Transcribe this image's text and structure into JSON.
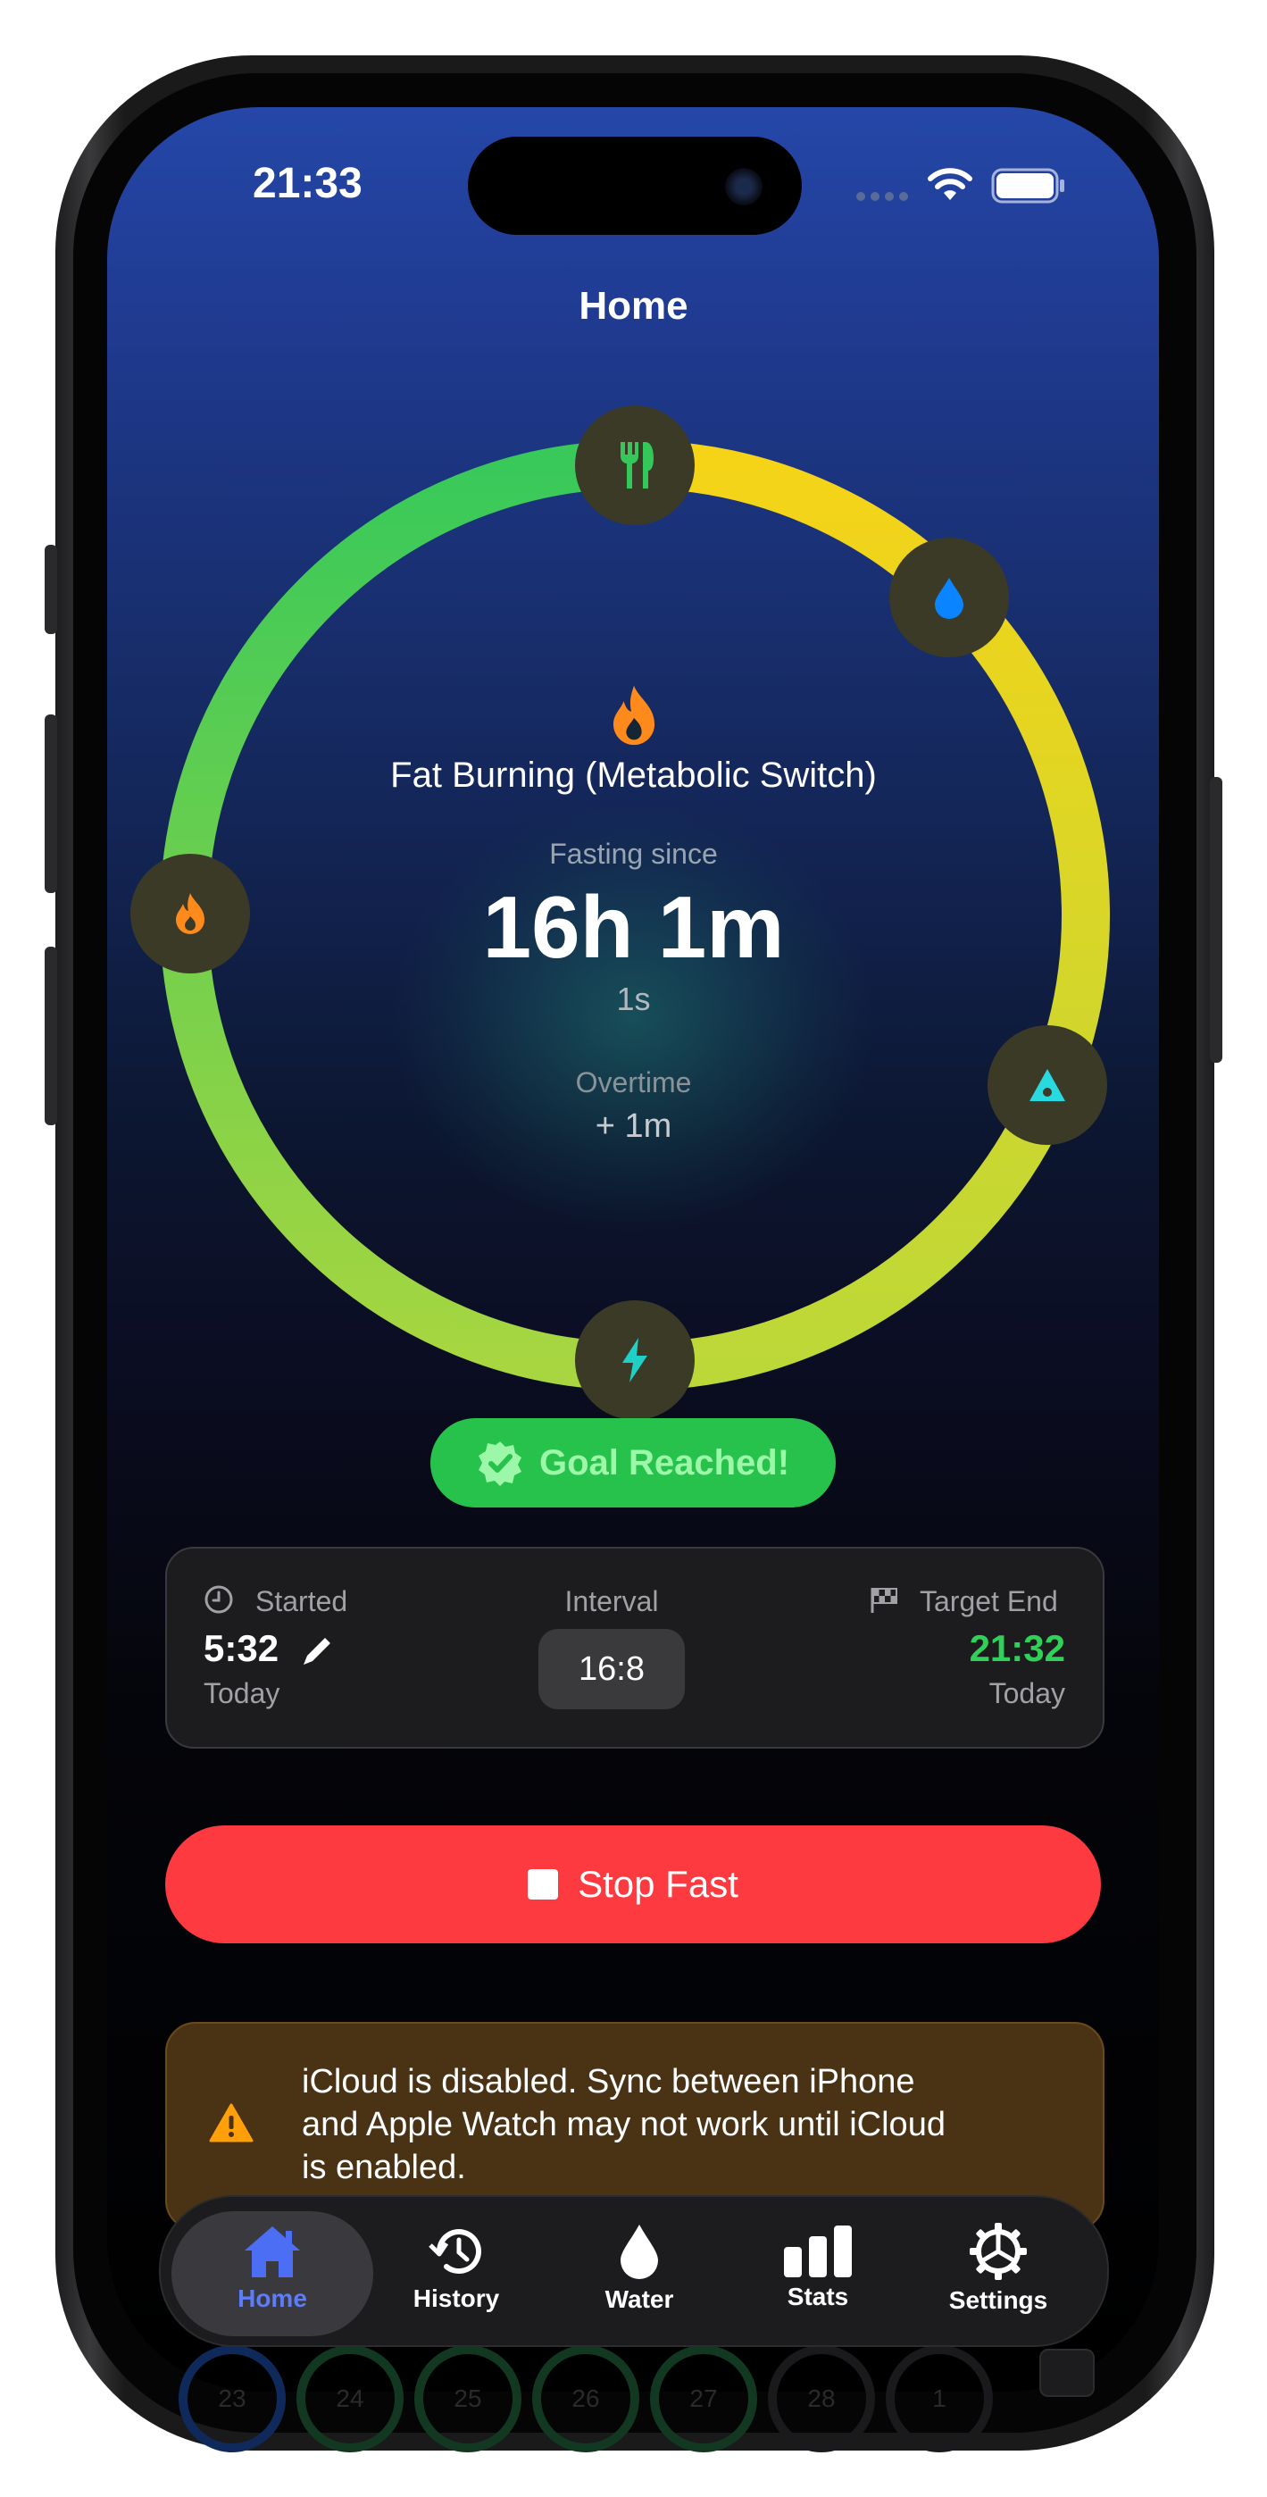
{
  "status_bar": {
    "time": "21:33",
    "wifi_icon": "wifi-icon",
    "battery_icon": "battery-icon"
  },
  "header": {
    "title": "Home"
  },
  "ring": {
    "stage_icon": "flame-icon",
    "stage_name": "Fat Burning (Metabolic Switch)",
    "fasting_since_label": "Fasting since",
    "elapsed_main": "16h 1m",
    "elapsed_seconds": "1s",
    "overtime_label": "Overtime",
    "overtime_value": "+ 1m",
    "progress": 1.0,
    "nodes": [
      "fork-knife-icon",
      "water-drop-icon",
      "ketone-icon",
      "bolt-icon",
      "flame-icon"
    ]
  },
  "goal_badge": {
    "label": "Goal Reached!",
    "icon": "check-seal-icon"
  },
  "fast_card": {
    "started_label": "Started",
    "started_time": "5:32",
    "started_day": "Today",
    "interval_label": "Interval",
    "interval_value": "16:8",
    "target_label": "Target End",
    "target_time": "21:32",
    "target_day": "Today"
  },
  "stop_button": {
    "label": "Stop Fast"
  },
  "warning": {
    "text_line1": "iCloud is disabled. Sync between iPhone",
    "text_line2": "and Apple Watch may not work until iCloud",
    "text_line3": "is enabled."
  },
  "tabs": [
    {
      "label": "Home",
      "icon": "house-icon",
      "active": true
    },
    {
      "label": "History",
      "icon": "history-icon"
    },
    {
      "label": "Water",
      "icon": "water-drop-icon"
    },
    {
      "label": "Stats",
      "icon": "bar-chart-icon"
    },
    {
      "label": "Settings",
      "icon": "gear-icon"
    }
  ],
  "behind_tabbar": {
    "days": [
      "23",
      "24",
      "25",
      "26",
      "27",
      "28",
      "1"
    ]
  },
  "colors": {
    "accent": "#3b5bdb",
    "success": "#30d158",
    "danger": "#fe3a41",
    "warning": "#ff9f0a"
  }
}
